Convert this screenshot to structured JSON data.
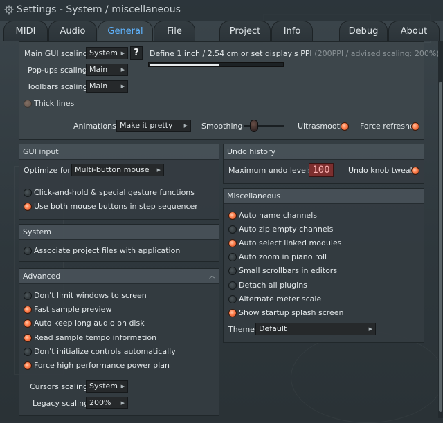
{
  "window": {
    "title": "Settings - System / miscellaneous"
  },
  "tabs": [
    {
      "label": "MIDI"
    },
    {
      "label": "Audio"
    },
    {
      "label": "General"
    },
    {
      "label": "File"
    },
    {
      "label": "Project"
    },
    {
      "label": "Info"
    },
    {
      "label": "Debug"
    },
    {
      "label": "About"
    }
  ],
  "scaling": {
    "main_label": "Main GUI scaling",
    "main_value": "System",
    "popups_label": "Pop-ups scaling",
    "popups_value": "Main",
    "toolbars_label": "Toolbars scaling",
    "toolbars_value": "Main",
    "help_label": "?",
    "ppi_label": "Define 1 inch / 2.54 cm or set display's PPI",
    "ppi_info": "(200PPI / advised scaling: 200%)",
    "ppi_slider_level": 0.52,
    "thick_lines_label": "Thick lines",
    "thick_lines_enabled": false
  },
  "animations": {
    "label": "Animations",
    "value": "Make it pretty",
    "smoothing_label": "Smoothing",
    "ultrasmooth_label": "Ultrasmooth",
    "ultrasmooth_on": true,
    "force_refreshes_label": "Force refreshes",
    "force_refreshes_on": true
  },
  "gui_input": {
    "header": "GUI input",
    "optimize_label": "Optimize for",
    "optimize_value": "Multi-button mouse",
    "options": [
      {
        "label": "Click-and-hold & special gesture functions",
        "on": false
      },
      {
        "label": "Use both mouse buttons in step sequencer",
        "on": true
      }
    ]
  },
  "system": {
    "header": "System",
    "options": [
      {
        "label": "Associate project files with application",
        "on": false
      }
    ]
  },
  "advanced": {
    "header": "Advanced",
    "options": [
      {
        "label": "Don't limit windows to screen",
        "on": false
      },
      {
        "label": "Fast sample preview",
        "on": true
      },
      {
        "label": "Auto keep long audio on disk",
        "on": true
      },
      {
        "label": "Read sample tempo information",
        "on": true
      },
      {
        "label": "Don't initialize controls automatically",
        "on": false
      },
      {
        "label": "Force high performance power plan",
        "on": true
      }
    ],
    "cursors_label": "Cursors scaling",
    "cursors_value": "System",
    "legacy_label": "Legacy scaling",
    "legacy_value": "200%"
  },
  "undo": {
    "header": "Undo history",
    "max_label": "Maximum undo levels",
    "max_value": "100",
    "knob_tweaks_label": "Undo knob tweaks",
    "knob_tweaks_on": true
  },
  "misc": {
    "header": "Miscellaneous",
    "options": [
      {
        "label": "Auto name channels",
        "on": true
      },
      {
        "label": "Auto zip empty channels",
        "on": false
      },
      {
        "label": "Auto select linked modules",
        "on": true
      },
      {
        "label": "Auto zoom in piano roll",
        "on": false
      },
      {
        "label": "Small scrollbars in editors",
        "on": false
      },
      {
        "label": "Detach all plugins",
        "on": false
      },
      {
        "label": "Alternate meter scale",
        "on": false
      },
      {
        "label": "Show startup splash screen",
        "on": true
      }
    ],
    "theme_label": "Theme",
    "theme_value": "Default"
  },
  "colors": {
    "accent": "#5fb4ff",
    "led_on": "#ff7d4a",
    "undo_box": "#7d2f2f"
  },
  "icons": {
    "window": "gear-icon",
    "dropdown": "caret-right-icon",
    "slider": "slider-knob-icon"
  }
}
